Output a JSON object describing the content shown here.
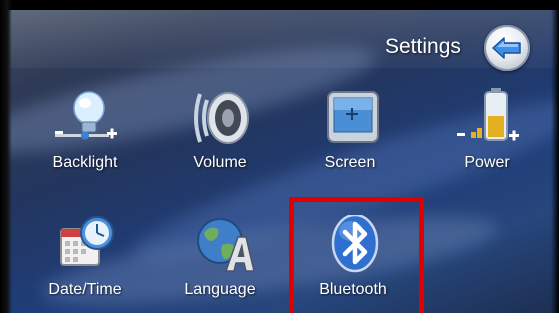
{
  "header": {
    "title": "Settings",
    "back_icon": "back-arrow-icon"
  },
  "tiles": [
    {
      "label": "Backlight",
      "icon": "backlight-bulb-icon"
    },
    {
      "label": "Volume",
      "icon": "speaker-icon"
    },
    {
      "label": "Screen",
      "icon": "screen-icon"
    },
    {
      "label": "Power",
      "icon": "battery-level-icon"
    },
    {
      "label": "Date/Time",
      "icon": "calendar-clock-icon"
    },
    {
      "label": "Language",
      "icon": "globe-language-icon"
    },
    {
      "label": "Bluetooth",
      "icon": "bluetooth-icon"
    }
  ],
  "selection": {
    "selected_tile": "Bluetooth",
    "highlight_color": "#e00000"
  },
  "colors": {
    "background": "#23365f",
    "text": "#ffffff",
    "accent": "#3a7fe0"
  }
}
